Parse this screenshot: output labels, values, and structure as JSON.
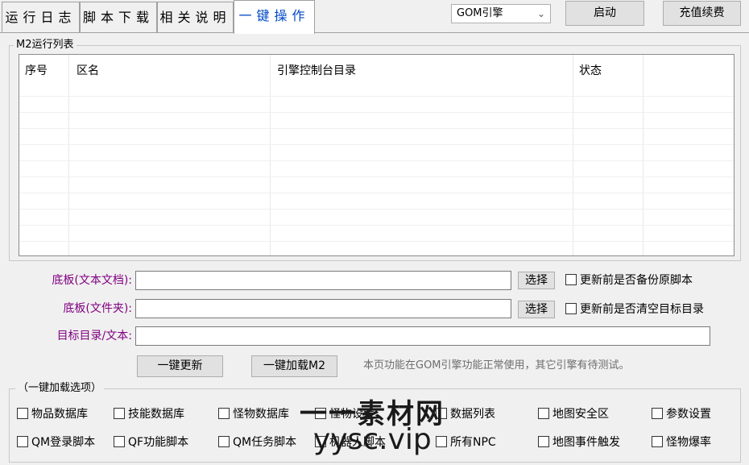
{
  "tabs": [
    {
      "label": "运行日志",
      "active": false
    },
    {
      "label": "脚本下载",
      "active": false
    },
    {
      "label": "相关说明",
      "active": false
    },
    {
      "label": "一键操作",
      "active": true
    }
  ],
  "engine_select": {
    "value": "GOM引擎"
  },
  "top_buttons": {
    "start": "启动",
    "recharge": "充值续费"
  },
  "list_group": {
    "title": "M2运行列表",
    "columns": [
      "序号",
      "区名",
      "引擎控制台目录",
      "状态"
    ],
    "rows": []
  },
  "form": {
    "template_doc": {
      "label": "底板(文本文档):",
      "value": "",
      "button": "选择",
      "checkbox": "更新前是否备份原脚本",
      "checked": false
    },
    "template_folder": {
      "label": "底板(文件夹):",
      "value": "",
      "button": "选择",
      "checkbox": "更新前是否清空目标目录",
      "checked": false
    },
    "target": {
      "label": "目标目录/文本:",
      "value": ""
    },
    "update_button": "一键更新",
    "load_button": "一键加载M2",
    "notice": "本页功能在GOM引擎功能正常使用，其它引擎有待测试。"
  },
  "options_group": {
    "title": "（一键加载选项）",
    "row1": [
      "物品数据库",
      "技能数据库",
      "怪物数据库",
      "怪物设置",
      "数据列表",
      "地图安全区",
      "参数设置"
    ],
    "row2": [
      "QM登录脚本",
      "QF功能脚本",
      "QM任务脚本",
      "机器人脚本",
      "所有NPC",
      "地图事件触发",
      "怪物爆率"
    ]
  },
  "watermark": {
    "cn": "一一素材网",
    "url": "yysc.vip"
  },
  "colors": {
    "active_tab": "#0048c8",
    "form_label": "#800080",
    "notice": "#6d6d6d"
  }
}
